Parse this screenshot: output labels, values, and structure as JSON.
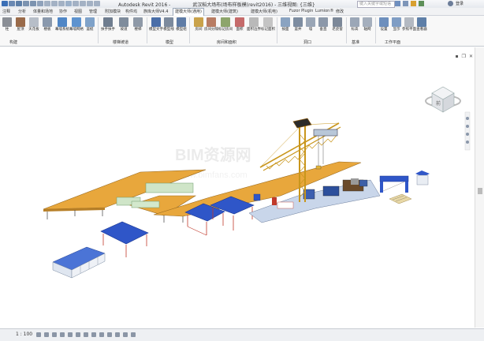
{
  "titlebar": {
    "app_name": "Autodesk Revit 2016 -",
    "document": "武汉稻大场布(场布样板模(revit2016) - 三维视图: {三维}",
    "search_placeholder": "键入关键字或短语",
    "login_label": "登录"
  },
  "tabs": [
    "注释",
    "分析",
    "体量和场地",
    "协作",
    "视图",
    "管理",
    "附加模块",
    "构件坞",
    "族库大师V4.4",
    "建模大师(通用)",
    "建模大师(建筑)",
    "建模大师(机电)",
    "Fuzor Plugin",
    "Lumion®",
    "修改"
  ],
  "active_tab_index": 9,
  "ribbon": {
    "tools": [
      "柱",
      "屋顶",
      "天花板",
      "楼板",
      "幕墙系统",
      "幕墙网格",
      "竖梃",
      "扶手扶手",
      "坡道",
      "楼梯",
      "模型文字",
      "模型线",
      "模型组",
      "房间",
      "房间分隔",
      "标记房间",
      "面积",
      "面积边界",
      "标记面积",
      "按面",
      "竖井",
      "墙",
      "垂直",
      "老虎窗",
      "标高",
      "轴网",
      "设置",
      "显示",
      "参照平面",
      "查看器"
    ],
    "panels": [
      "构建",
      "楼梯坡道",
      "模型",
      "房间和面积",
      "洞口",
      "基准",
      "工作平面"
    ]
  },
  "viewport": {
    "watermark": "BIM资源网",
    "watermark_url": "www.bimfans.com",
    "viewcube_label": "前"
  },
  "statusbar": {
    "left_text": "1 : 100",
    "scale_label": "1 : 100"
  },
  "colors": {
    "roof_orange": "#e8a73c",
    "roof_blue": "#2f56c8",
    "crane_yellow": "#c9961c",
    "ribbon_bg": "#f8f8f8"
  }
}
